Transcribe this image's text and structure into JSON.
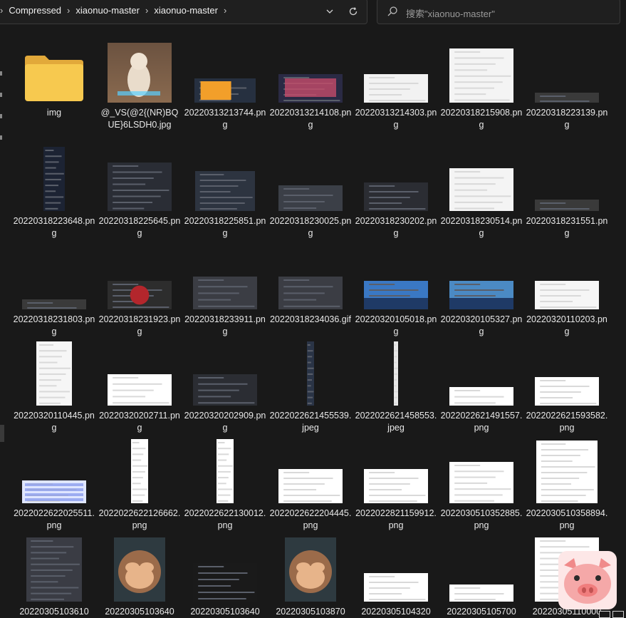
{
  "address": {
    "crumbs": [
      "Compressed",
      "xiaonuo-master",
      "xiaonuo-master"
    ],
    "dropdown_icon": "chevron-down-icon",
    "refresh_icon": "refresh-icon"
  },
  "search": {
    "placeholder": "搜索\"xiaonuo-master\"",
    "icon": "search-icon"
  },
  "files": [
    {
      "name": "img",
      "kind": "folder"
    },
    {
      "name": "@_VS(@2{(NR)BQUE}6LSDH0.jpg",
      "kind": "cat"
    },
    {
      "name": "20220313213744.png",
      "kind": "shot"
    },
    {
      "name": "20220313214108.png",
      "kind": "shot"
    },
    {
      "name": "20220313214303.png",
      "kind": "shot"
    },
    {
      "name": "20220318215908.png",
      "kind": "shot"
    },
    {
      "name": "20220318223139.png",
      "kind": "shot"
    },
    {
      "name": "20220318223648.png",
      "kind": "shot"
    },
    {
      "name": "20220318225645.png",
      "kind": "shot"
    },
    {
      "name": "20220318225851.png",
      "kind": "shot"
    },
    {
      "name": "20220318230025.png",
      "kind": "shot"
    },
    {
      "name": "20220318230202.png",
      "kind": "shot"
    },
    {
      "name": "20220318230514.png",
      "kind": "shot"
    },
    {
      "name": "20220318231551.png",
      "kind": "shot"
    },
    {
      "name": "20220318231803.png",
      "kind": "shot"
    },
    {
      "name": "20220318231923.png",
      "kind": "shot"
    },
    {
      "name": "20220318233911.png",
      "kind": "shot"
    },
    {
      "name": "20220318234036.gif",
      "kind": "shot"
    },
    {
      "name": "20220320105018.png",
      "kind": "shot"
    },
    {
      "name": "20220320105327.png",
      "kind": "shot"
    },
    {
      "name": "20220320110203.png",
      "kind": "shot"
    },
    {
      "name": "20220320110445.png",
      "kind": "shot"
    },
    {
      "name": "20220320202711.png",
      "kind": "shot"
    },
    {
      "name": "20220320202909.png",
      "kind": "shot"
    },
    {
      "name": "2022022621455539.jpeg",
      "kind": "shot"
    },
    {
      "name": "2022022621458553.jpeg",
      "kind": "shot"
    },
    {
      "name": "2022022621491557.png",
      "kind": "shot"
    },
    {
      "name": "2022022621593582.png",
      "kind": "shot"
    },
    {
      "name": "2022022622025511.png",
      "kind": "shot"
    },
    {
      "name": "2022022622126662.png",
      "kind": "shot"
    },
    {
      "name": "2022022622130012.png",
      "kind": "shot"
    },
    {
      "name": "2022022622204445.png",
      "kind": "shot"
    },
    {
      "name": "2022022821159912.png",
      "kind": "shot"
    },
    {
      "name": "2022030510352885.png",
      "kind": "shot"
    },
    {
      "name": "2022030510358894.png",
      "kind": "shot"
    },
    {
      "name": "20220305103610",
      "kind": "shot"
    },
    {
      "name": "20220305103640",
      "kind": "monkey"
    },
    {
      "name": "20220305103640",
      "kind": "shot"
    },
    {
      "name": "20220305103870",
      "kind": "monkey"
    },
    {
      "name": "20220305104320",
      "kind": "shot"
    },
    {
      "name": "20220305105700",
      "kind": "shot"
    },
    {
      "name": "20220305110000",
      "kind": "shot"
    }
  ],
  "colors": {
    "background": "#191919",
    "text": "#e8e8e8",
    "folder": "#f5c44e",
    "accent_blue": "#2a6fd6"
  }
}
